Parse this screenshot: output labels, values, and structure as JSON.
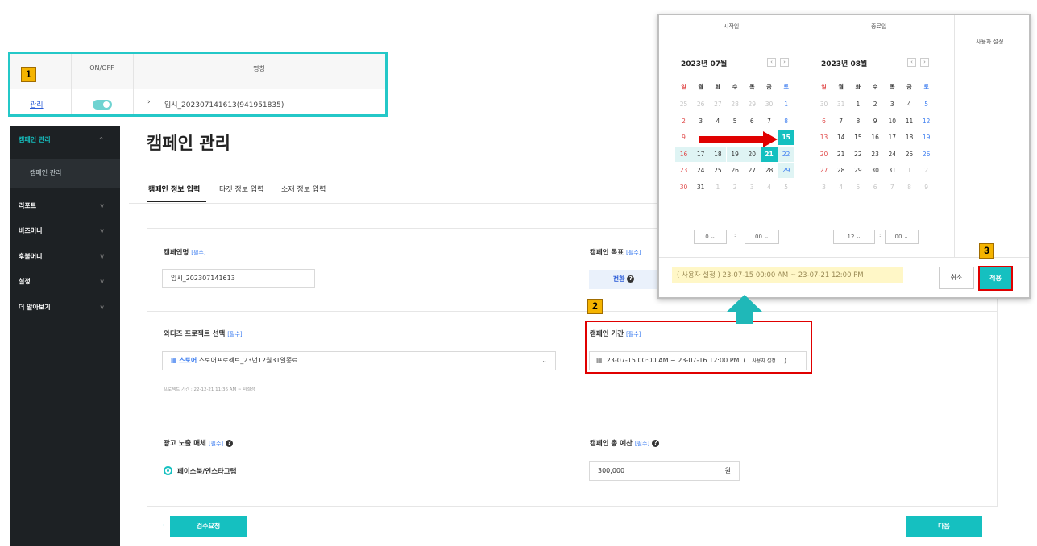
{
  "campaign_list": {
    "badge": "1",
    "columns": [
      "ON/OFF",
      "명칭"
    ],
    "row": {
      "manage_link": "관리",
      "name": "임시_202307141613(941951835)"
    }
  },
  "sidebar": {
    "sections": [
      {
        "label": "캠페인 관리",
        "active": true,
        "chevron": "^"
      },
      {
        "label": "리포트",
        "chevron": "v"
      },
      {
        "label": "비즈머니",
        "chevron": "v"
      },
      {
        "label": "후불머니",
        "chevron": "v"
      },
      {
        "label": "설정",
        "chevron": "v"
      },
      {
        "label": "더 알아보기",
        "chevron": "v"
      }
    ],
    "sub_item": "캠페인 관리"
  },
  "page": {
    "title": "캠페인 관리",
    "tabs": [
      "캠페인 정보 입력",
      "타겟 정보 입력",
      "소재 정보 입력"
    ]
  },
  "form": {
    "campaign_name_label": "캠페인명",
    "campaign_name_value": "임시_202307141613",
    "campaign_goal_label": "캠페인 목표",
    "goal_button": "전환",
    "required": "[필수]",
    "project_label": "와디즈 프로젝트 선택",
    "project_store_tag": "스토어",
    "project_value": "스토어프로젝트_23년12월31일종료",
    "project_period": "프로젝트 기간 : 22-12-21 11:36 AM ~ 미설정",
    "period_label": "캠페인 기간",
    "period_value": "23-07-15 00:00 AM ~ 23-07-16 12:00 PM",
    "period_open": "(",
    "period_mode": "사용자 설정",
    "period_close": ")",
    "media_label": "광고 노출 매체",
    "media_option": "페이스북/인스타그램",
    "budget_label": "캠페인 총 예산",
    "budget_value": "300,000",
    "budget_unit": "원",
    "review_button": "검수요청",
    "next_button": "다음",
    "bullet": "·"
  },
  "badges": {
    "two": "2",
    "three": "3"
  },
  "calendar": {
    "start_header": "시작일",
    "end_header": "종료일",
    "custom_setting": "사용자 설정",
    "left_month": "2023년 07월",
    "right_month": "2023년 08월",
    "weekdays": [
      "일",
      "월",
      "화",
      "수",
      "목",
      "금",
      "토"
    ],
    "left_days": [
      [
        "25",
        "26",
        "27",
        "28",
        "29",
        "30",
        "1"
      ],
      [
        "2",
        "3",
        "4",
        "5",
        "6",
        "7",
        "8"
      ],
      [
        "9",
        "",
        "",
        "",
        "",
        "",
        "15"
      ],
      [
        "16",
        "17",
        "18",
        "19",
        "20",
        "21",
        "22"
      ],
      [
        "23",
        "24",
        "25",
        "26",
        "27",
        "28",
        "29"
      ],
      [
        "30",
        "31",
        "1",
        "2",
        "3",
        "4",
        "5"
      ]
    ],
    "right_days": [
      [
        "30",
        "31",
        "1",
        "2",
        "3",
        "4",
        "5"
      ],
      [
        "6",
        "7",
        "8",
        "9",
        "10",
        "11",
        "12"
      ],
      [
        "13",
        "14",
        "15",
        "16",
        "17",
        "18",
        "19"
      ],
      [
        "20",
        "21",
        "22",
        "23",
        "24",
        "25",
        "26"
      ],
      [
        "27",
        "28",
        "29",
        "30",
        "31",
        "1",
        "2"
      ],
      [
        "3",
        "4",
        "5",
        "6",
        "7",
        "8",
        "9"
      ]
    ],
    "start_time": {
      "hour": "0",
      "minute": "00"
    },
    "end_time": {
      "hour": "12",
      "minute": "00"
    },
    "time_sep": ":",
    "summary": "( 사용자 설정 )  23-07-15 00:00 AM ~ 23-07-21 12:00 PM",
    "cancel": "취소",
    "apply": "적용"
  },
  "colors": {
    "teal": "#15c0c0",
    "highlight_box": "#24c8c8",
    "red": "#e00000",
    "badge": "#f5b400",
    "sunday": "#e04848",
    "saturday": "#3c7df0"
  }
}
